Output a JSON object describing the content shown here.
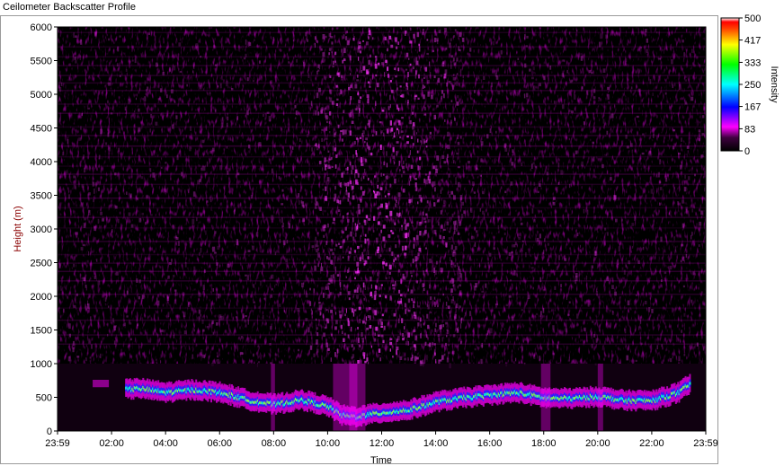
{
  "window": {
    "title": "Ceilometer Backscatter Profile"
  },
  "chart_data": {
    "type": "heatmap",
    "title": "",
    "xlabel": "Time",
    "ylabel": "Height (m)",
    "x_ticks": [
      "23:59",
      "02:00",
      "04:00",
      "06:00",
      "08:00",
      "10:00",
      "12:00",
      "14:00",
      "16:00",
      "18:00",
      "20:00",
      "22:00",
      "23:59"
    ],
    "y_ticks": [
      0,
      500,
      1000,
      1500,
      2000,
      2500,
      3000,
      3500,
      4000,
      4500,
      5000,
      5500,
      6000
    ],
    "ylim": [
      0,
      6000
    ],
    "xlim_hours": [
      0,
      24
    ],
    "colorbar": {
      "label": "Intensity",
      "range": [
        0,
        500
      ],
      "ticks": [
        0,
        83,
        167,
        250,
        333,
        417,
        500
      ],
      "colors": [
        "#000000",
        "#ff00ff",
        "#0000ff",
        "#00ffff",
        "#00ff00",
        "#ffff00",
        "#ff8000",
        "#ff0000",
        "#ffffff"
      ]
    },
    "boundary_layer": {
      "description_units": "hours since 23:59, height m",
      "points": [
        [
          2.5,
          600
        ],
        [
          3.0,
          620
        ],
        [
          4.0,
          560
        ],
        [
          5.0,
          600
        ],
        [
          6.0,
          560
        ],
        [
          7.0,
          450
        ],
        [
          8.0,
          380
        ],
        [
          9.0,
          450
        ],
        [
          10.0,
          350
        ],
        [
          10.5,
          220
        ],
        [
          11.0,
          200
        ],
        [
          12.0,
          260
        ],
        [
          13.0,
          300
        ],
        [
          14.0,
          420
        ],
        [
          15.0,
          480
        ],
        [
          16.0,
          520
        ],
        [
          17.0,
          560
        ],
        [
          18.0,
          480
        ],
        [
          19.0,
          470
        ],
        [
          20.0,
          500
        ],
        [
          21.0,
          440
        ],
        [
          22.0,
          440
        ],
        [
          23.0,
          560
        ],
        [
          23.4,
          700
        ]
      ]
    },
    "grid": false,
    "legend": "colorbar-right"
  }
}
